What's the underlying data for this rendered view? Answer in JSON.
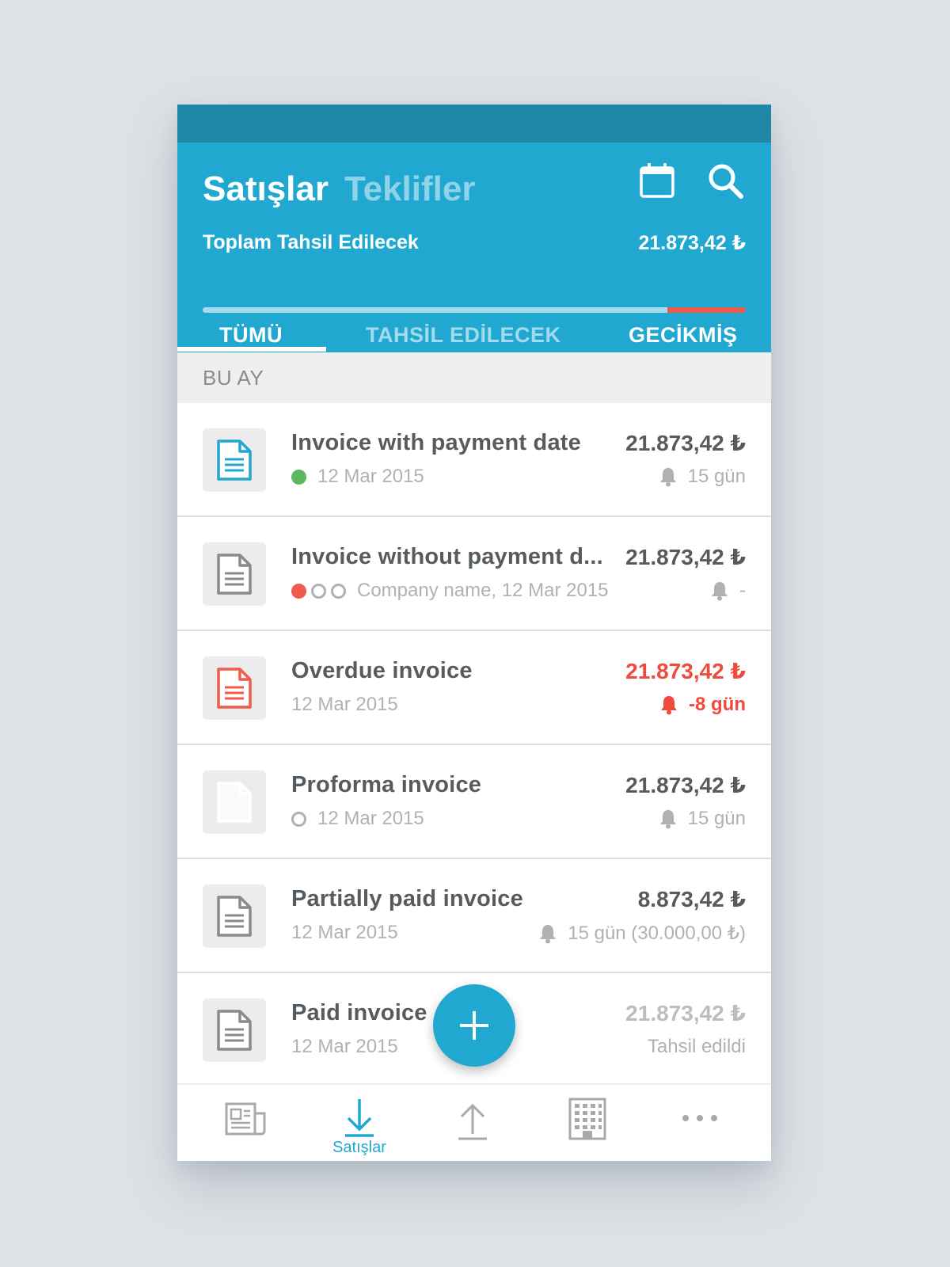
{
  "header": {
    "title_active": "Satışlar",
    "title_inactive": "Teklifler",
    "total_label": "Toplam Tahsil Edilecek",
    "total_value": "21.873,42 ₺",
    "progress_fraction": 0.855,
    "colors": {
      "primary": "#21a8d0",
      "status_bar": "#1e87a5",
      "overdue": "#ef5b4c"
    },
    "icons": [
      "calendar-icon",
      "search-icon"
    ]
  },
  "tabs": [
    {
      "label": "TÜMÜ",
      "selected": true
    },
    {
      "label": "TAHSİL EDİLECEK",
      "selected": false
    },
    {
      "label": "GECİKMİŞ",
      "selected": false
    }
  ],
  "section": {
    "label": "BU AY"
  },
  "invoices": [
    {
      "title": "Invoice with payment date",
      "subtitle": "12 Mar 2015",
      "amount": "21.873,42 ₺",
      "due": "15 gün",
      "status": "green-dot",
      "icon_color": "#21a8d0"
    },
    {
      "title": "Invoice without payment d...",
      "subtitle": "Company name, 12 Mar 2015",
      "amount": "21.873,42 ₺",
      "due": "-",
      "status": "red-dot, empty-dot, empty-dot",
      "icon_color": "#8a8a8a"
    },
    {
      "title": "Overdue invoice",
      "subtitle": "12 Mar 2015",
      "amount": "21.873,42 ₺",
      "due": "-8 gün",
      "status": "overdue",
      "icon_color": "#ef5b4c"
    },
    {
      "title": "Proforma invoice",
      "subtitle": "12 Mar 2015",
      "amount": "21.873,42 ₺",
      "due": "15 gün",
      "status": "empty-dot",
      "icon_color": "#ffffff"
    },
    {
      "title": "Partially paid invoice",
      "subtitle": "12 Mar 2015",
      "amount": "8.873,42 ₺",
      "due": "15 gün (30.000,00 ₺)",
      "status": "partial",
      "icon_color": "#8a8a8a"
    },
    {
      "title": "Paid invoice",
      "subtitle": "12 Mar 2015",
      "amount": "21.873,42 ₺",
      "due": "Tahsil edildi",
      "status": "paid",
      "icon_color": "#8a8a8a"
    }
  ],
  "fab": {
    "icon": "plus-icon"
  },
  "bottom_nav": [
    {
      "icon": "newspaper-icon",
      "label": ""
    },
    {
      "icon": "download-icon",
      "label": "Satışlar",
      "active": true
    },
    {
      "icon": "upload-icon",
      "label": ""
    },
    {
      "icon": "building-icon",
      "label": ""
    },
    {
      "icon": "more-icon",
      "label": ""
    }
  ]
}
